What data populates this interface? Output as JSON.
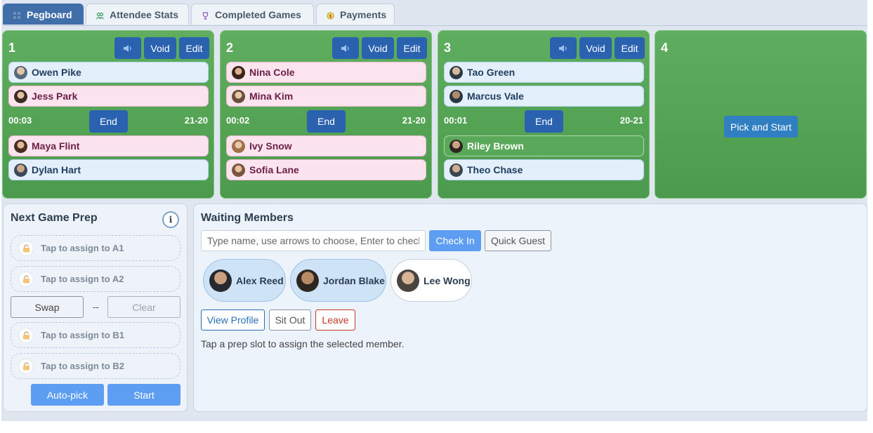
{
  "tabs": [
    {
      "label": "Pegboard",
      "icon": "grid-icon",
      "active": true
    },
    {
      "label": "Attendee Stats",
      "icon": "people-icon",
      "active": false
    },
    {
      "label": "Completed Games",
      "icon": "trophy-icon",
      "active": false
    },
    {
      "label": "Payments",
      "icon": "coin-icon",
      "active": false
    }
  ],
  "courts": [
    {
      "number": "1",
      "void_label": "Void",
      "edit_label": "Edit",
      "timer": "00:03",
      "end_label": "End",
      "score": "21-20",
      "players": [
        "Owen Pike",
        "Jess Park",
        "Maya Flint",
        "Dylan Hart"
      ]
    },
    {
      "number": "2",
      "void_label": "Void",
      "edit_label": "Edit",
      "timer": "00:02",
      "end_label": "End",
      "score": "21-20",
      "players": [
        "Nina Cole",
        "Mina Kim",
        "Ivy Snow",
        "Sofia Lane"
      ]
    },
    {
      "number": "3",
      "void_label": "Void",
      "edit_label": "Edit",
      "timer": "00:01",
      "end_label": "End",
      "score": "20-21",
      "players": [
        "Tao Green",
        "Marcus Vale",
        "Riley Brown",
        "Theo Chase"
      ]
    },
    {
      "number": "4",
      "pick_label": "Pick and Start"
    }
  ],
  "prep": {
    "title": "Next Game Prep",
    "info_label": "i",
    "slots": [
      "Tap to assign to A1",
      "Tap to assign to A2",
      "Tap to assign to B1",
      "Tap to assign to B2"
    ],
    "swap_label": "Swap",
    "separator": "--",
    "clear_label": "Clear",
    "autopick_label": "Auto-pick",
    "start_label": "Start"
  },
  "waiting": {
    "title": "Waiting Members",
    "search_placeholder": "Type name, use arrows to choose, Enter to check in",
    "checkin_label": "Check In",
    "quickguest_label": "Quick Guest",
    "members": [
      "Alex Reed",
      "Jordan Blake",
      "Lee Wong"
    ],
    "view_profile_label": "View Profile",
    "sit_out_label": "Sit Out",
    "leave_label": "Leave",
    "hint": "Tap a prep slot to assign the selected member."
  },
  "colors": {
    "court_green": "#4c9a4d",
    "accent_blue": "#2a62b0",
    "male_chip": "#e3f0fc",
    "female_chip": "#fce4ef",
    "leave_red": "#c0392b"
  }
}
